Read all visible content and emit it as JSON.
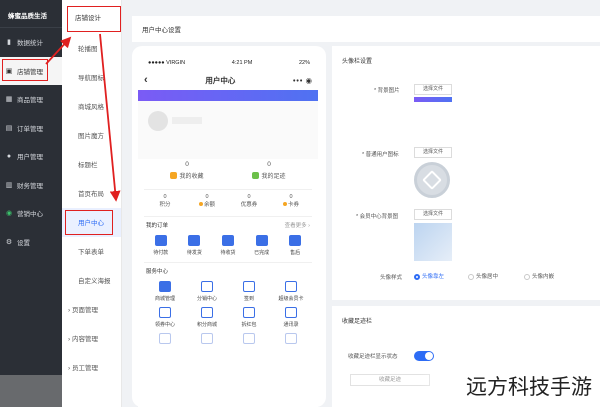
{
  "sidebar": {
    "brand": "蜂蜜品质生活",
    "items": [
      {
        "label": "数据统计",
        "icon": "chart-icon"
      },
      {
        "label": "店铺管理",
        "icon": "shop-icon"
      },
      {
        "label": "商品管理",
        "icon": "goods-icon"
      },
      {
        "label": "订单管理",
        "icon": "order-icon"
      },
      {
        "label": "用户管理",
        "icon": "user-icon"
      },
      {
        "label": "财务管理",
        "icon": "finance-icon"
      },
      {
        "label": "营销中心",
        "icon": "marketing-icon"
      },
      {
        "label": "设置",
        "icon": "gear-icon"
      }
    ]
  },
  "submenu": {
    "head": "店铺设计",
    "items": [
      "轮播图",
      "导航图标",
      "商城风格",
      "图片魔方",
      "标题栏",
      "首页布局",
      "用户中心",
      "下单表单",
      "自定义海报"
    ],
    "groups": [
      "页面管理",
      "内容管理",
      "员工管理"
    ]
  },
  "topbar": {
    "title": "用户中心设置"
  },
  "phone": {
    "carrier": "●●●●● VIRGIN",
    "time": "4:21 PM",
    "battery": "22%",
    "title": "用户中心",
    "back": "‹",
    "dots": "•••",
    "favorites": {
      "value": "0",
      "label": "我的收藏"
    },
    "footprints": {
      "value": "0",
      "label": "我的足迹"
    },
    "small_stats": [
      {
        "value": "0",
        "label": "积分"
      },
      {
        "value": "0",
        "label": "余额"
      },
      {
        "value": "0",
        "label": "优惠券"
      },
      {
        "value": "0",
        "label": "卡券"
      }
    ],
    "orders": {
      "title": "我的订单",
      "more": "查看更多 ›",
      "items": [
        "待付款",
        "待发货",
        "待收货",
        "已完成",
        "售后"
      ]
    },
    "services": {
      "title": "服务中心",
      "row1": [
        "商城管理",
        "分销中心",
        "签到",
        "超级会员卡"
      ],
      "row2": [
        "领券中心",
        "积分商城",
        "拆红包",
        "通讯录"
      ]
    }
  },
  "panel": {
    "title": "头像栏设置",
    "bg_image_label": "* 背景图片",
    "normal_avatar_label": "* 普通用户图标",
    "center_bg_label": "* 会员中心背景图",
    "file_btn": "选择文件",
    "avatar_style_label": "头像样式",
    "avatar_styles": [
      "头像靠左",
      "头像居中",
      "头像内嵌"
    ],
    "selected_style": "头像靠左"
  },
  "panel2": {
    "title": "收藏足迹栏",
    "toggle_label": "收藏足迹栏显示状态",
    "toggle_on": true,
    "fav_placeholder": "收藏足迹"
  },
  "watermark": "远方科技手游"
}
